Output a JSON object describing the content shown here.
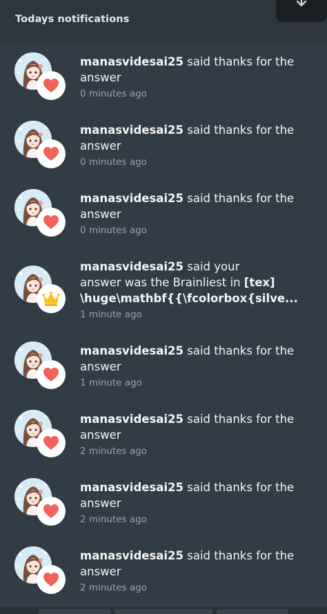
{
  "header": {
    "title": "Todays notifications",
    "download_icon": "download-icon"
  },
  "colors": {
    "heart": "#f0625a",
    "crown": "#f7c21b",
    "background": "#323c46",
    "timestamp": "#9aa3ad"
  },
  "notifications": [
    {
      "user": "manasvidesai25",
      "line1": "said thanks for the",
      "line2": "answer",
      "time": "0 minutes ago",
      "badge": "heart-icon"
    },
    {
      "user": "manasvidesai25",
      "line1": "said thanks for the",
      "line2": "answer",
      "time": "0 minutes ago",
      "badge": "heart-icon"
    },
    {
      "user": "manasvidesai25",
      "line1": "said thanks for the",
      "line2": "answer",
      "time": "0 minutes ago",
      "badge": "heart-icon"
    },
    {
      "user": "manasvidesai25",
      "line1": "said your",
      "line2": "answer was the Brainliest in",
      "line2_tex": "[tex]",
      "line3": "\\huge\\mathbf{{\\fcolorbox{silve...",
      "time": "1 minute ago",
      "badge": "crown-icon"
    },
    {
      "user": "manasvidesai25",
      "line1": "said thanks for the",
      "line2": "answer",
      "time": "1 minute ago",
      "badge": "heart-icon"
    },
    {
      "user": "manasvidesai25",
      "line1": "said thanks for the",
      "line2": "answer",
      "time": "2 minutes ago",
      "badge": "heart-icon"
    },
    {
      "user": "manasvidesai25",
      "line1": "said thanks for the",
      "line2": "answer",
      "time": "2 minutes ago",
      "badge": "heart-icon"
    },
    {
      "user": "manasvidesai25",
      "line1": "said thanks for the",
      "line2": "answer",
      "time": "2 minutes ago",
      "badge": "heart-icon"
    }
  ]
}
